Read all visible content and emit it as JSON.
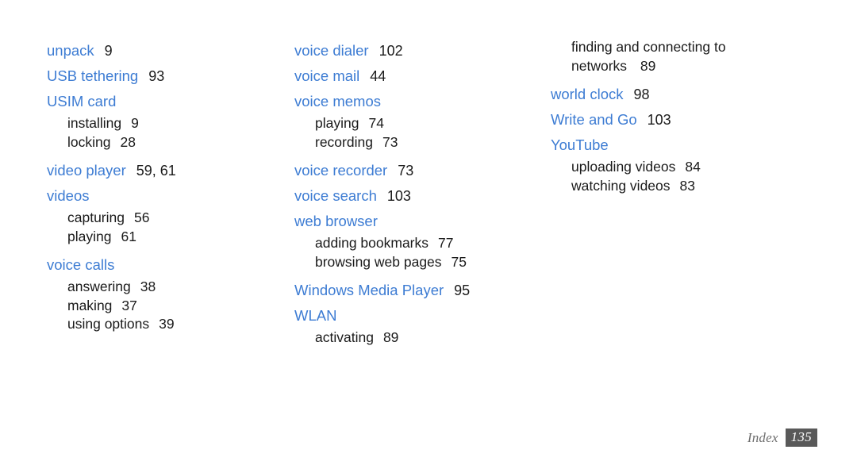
{
  "document": {
    "type": "index-page",
    "accent_color": "#3d7cd3",
    "text_color": "#1a1a1a",
    "background": "#ffffff"
  },
  "columns": [
    {
      "id": "column-1",
      "groups": [
        {
          "main": {
            "label": "unpack",
            "pages": "9"
          },
          "subs": []
        },
        {
          "main": {
            "label": "USB tethering",
            "pages": "93"
          },
          "subs": []
        },
        {
          "main": {
            "label": "USIM card",
            "pages": ""
          },
          "subs": [
            {
              "label": "installing",
              "pages": "9"
            },
            {
              "label": "locking",
              "pages": "28"
            }
          ]
        },
        {
          "main": {
            "label": "video player",
            "pages": "59, 61"
          },
          "subs": []
        },
        {
          "main": {
            "label": "videos",
            "pages": ""
          },
          "subs": [
            {
              "label": "capturing",
              "pages": "56"
            },
            {
              "label": "playing",
              "pages": "61"
            }
          ]
        },
        {
          "main": {
            "label": "voice calls",
            "pages": ""
          },
          "subs": [
            {
              "label": "answering",
              "pages": "38"
            },
            {
              "label": "making",
              "pages": "37"
            },
            {
              "label": "using options",
              "pages": "39"
            }
          ]
        }
      ]
    },
    {
      "id": "column-2",
      "groups": [
        {
          "main": {
            "label": "voice dialer",
            "pages": "102"
          },
          "subs": []
        },
        {
          "main": {
            "label": "voice mail",
            "pages": "44"
          },
          "subs": []
        },
        {
          "main": {
            "label": "voice memos",
            "pages": ""
          },
          "subs": [
            {
              "label": "playing",
              "pages": "74"
            },
            {
              "label": "recording",
              "pages": "73"
            }
          ]
        },
        {
          "main": {
            "label": "voice recorder",
            "pages": "73"
          },
          "subs": []
        },
        {
          "main": {
            "label": "voice search",
            "pages": "103"
          },
          "subs": []
        },
        {
          "main": {
            "label": "web browser",
            "pages": ""
          },
          "subs": [
            {
              "label": "adding bookmarks",
              "pages": "77"
            },
            {
              "label": "browsing web pages",
              "pages": "75"
            }
          ]
        },
        {
          "main": {
            "label": "Windows Media Player",
            "pages": "95"
          },
          "subs": []
        },
        {
          "main": {
            "label": "WLAN",
            "pages": ""
          },
          "subs": [
            {
              "label": "activating",
              "pages": "89"
            }
          ]
        }
      ]
    },
    {
      "id": "column-3",
      "continued_subs": [
        {
          "label": "finding and connecting to networks",
          "pages": "89"
        }
      ],
      "groups": [
        {
          "main": {
            "label": "world clock",
            "pages": "98"
          },
          "subs": []
        },
        {
          "main": {
            "label": "Write and Go",
            "pages": "103"
          },
          "subs": []
        },
        {
          "main": {
            "label": "YouTube",
            "pages": ""
          },
          "subs": [
            {
              "label": "uploading videos",
              "pages": "84"
            },
            {
              "label": "watching videos",
              "pages": "83"
            }
          ]
        }
      ]
    }
  ],
  "footer": {
    "label": "Index",
    "page_number": "135"
  }
}
